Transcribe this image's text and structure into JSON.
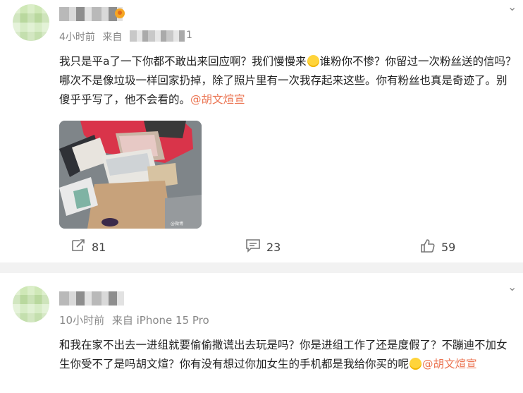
{
  "post1": {
    "time": "4小时前",
    "source_prefix": "来自",
    "source_tail": "1",
    "text_before_emoji1": "我只是平a了一下你都不敢出来回应啊？我们慢慢来",
    "text_after_emoji1": "谁粉你不惨？你留过一次粉丝送的信吗？哪次不是像垃圾一样回家扔掉，除了照片里有一次我存起来这些。你有粉丝也真是奇迹了。别傻乎乎写了，他不会看的。",
    "mention": "@胡文煊宣",
    "actions": {
      "reposts": "81",
      "comments": "23",
      "likes": "59"
    }
  },
  "post2": {
    "time": "10小时前",
    "source": "来自 iPhone 15 Pro",
    "text_before_emoji": "和我在家不出去一进组就要偷偷撒谎出去玩是吗？你是进组工作了还是度假了？不蹦迪不加女生你受不了是吗胡文煊？你有没有想过你加女生的手机都是我给你买的呢",
    "mention": "@胡文煊宣"
  },
  "icons": {
    "chevron": "chevron-down-icon",
    "repost": "repost-icon",
    "comment": "comment-icon",
    "like": "like-icon",
    "emoji": "smile-emoji-icon"
  },
  "colors": {
    "mention": "#eb7350",
    "meta": "#888888",
    "separator": "#f2f2f2"
  }
}
